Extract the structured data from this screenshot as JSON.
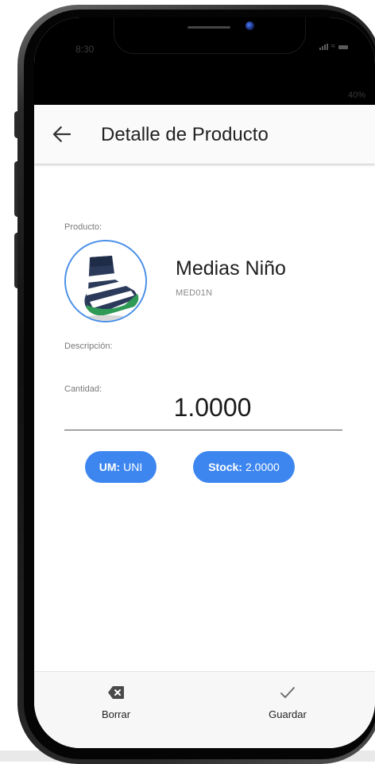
{
  "status": {
    "time": "8:30",
    "battery": "40%"
  },
  "appbar": {
    "title": "Detalle de Producto",
    "back_icon": "arrow-left-icon"
  },
  "product": {
    "label": "Producto:",
    "name": "Medias Niño",
    "code": "MED01N",
    "image_icon": "sock-icon"
  },
  "description": {
    "label": "Descripción:"
  },
  "quantity": {
    "label": "Cantidad:",
    "value": "1.0000"
  },
  "chips": {
    "um_label": "UM:",
    "um_value": "UNI",
    "stock_label": "Stock:",
    "stock_value": "2.0000"
  },
  "actions": {
    "delete_label": "Borrar",
    "delete_icon": "backspace-icon",
    "save_label": "Guardar",
    "save_icon": "check-icon"
  },
  "colors": {
    "accent": "#3d86f0",
    "avatar_border": "#4a90e8"
  }
}
